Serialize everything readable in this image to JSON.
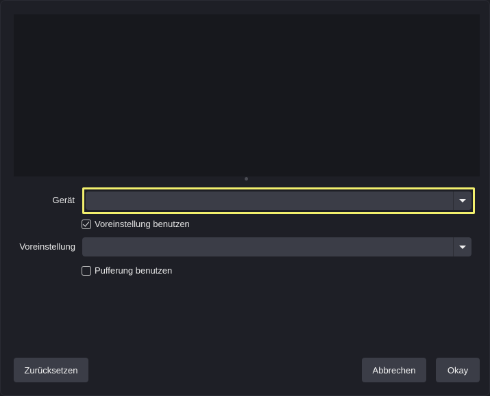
{
  "form": {
    "device_label": "Gerät",
    "device_value": "",
    "use_preset_label": "Voreinstellung benutzen",
    "use_preset_checked": true,
    "preset_label": "Voreinstellung",
    "preset_value": "",
    "buffering_label": "Pufferung benutzen",
    "buffering_checked": false
  },
  "buttons": {
    "reset_label": "Zurücksetzen",
    "cancel_label": "Abbrechen",
    "ok_label": "Okay"
  },
  "colors": {
    "focus": "#f2ef6d",
    "background": "#1e1f26",
    "control": "#3b3d47"
  },
  "icons": {
    "dropdown": "chevron-down-icon",
    "check": "checkmark-icon"
  }
}
